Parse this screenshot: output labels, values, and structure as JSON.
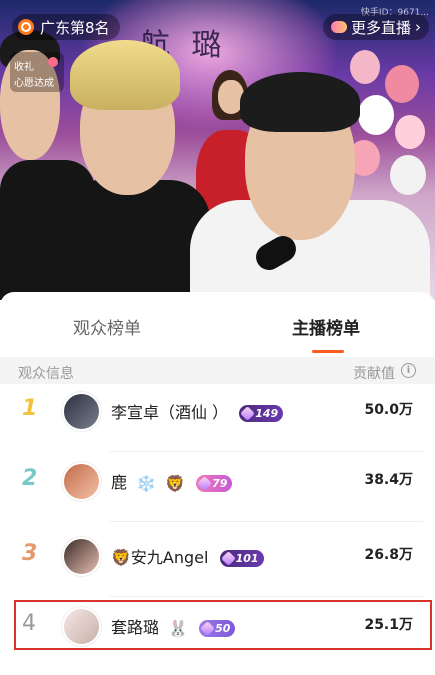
{
  "live": {
    "rank_label": "广东第8名",
    "more_live_label": "更多直播",
    "wish": {
      "line1": "收礼",
      "line2": "心愿达成"
    },
    "kuaishou_id": "快手ID：9671..."
  },
  "tabs": [
    {
      "label": "观众榜单",
      "active": false
    },
    {
      "label": "主播榜单",
      "active": true
    }
  ],
  "list_header": {
    "left": "观众信息",
    "right": "贡献值"
  },
  "rows": [
    {
      "rank": "1",
      "name": "李宣卓（酒仙 ）",
      "emojis": [],
      "badge_level": "149",
      "badge_style": "purple",
      "value": "50.0万",
      "rank_color": "#f2c23a"
    },
    {
      "rank": "2",
      "name": "鹿",
      "emojis": [
        "❄️",
        "🦁"
      ],
      "badge_level": "79",
      "badge_style": "pink",
      "value": "38.4万",
      "rank_color": "#7ac9c9"
    },
    {
      "rank": "3",
      "name": "🦁安九Angel",
      "emojis": [],
      "badge_level": "101",
      "badge_style": "purple",
      "value": "26.8万",
      "rank_color": "#e39b6c"
    },
    {
      "rank": "4",
      "name": "套路璐",
      "emojis": [
        "🐰"
      ],
      "badge_level": "50",
      "badge_style": "lav",
      "value": "25.1万",
      "rank_color": "#999999"
    }
  ],
  "colors": {
    "accent": "#ff5a1f",
    "highlight_border": "#d9342b"
  }
}
